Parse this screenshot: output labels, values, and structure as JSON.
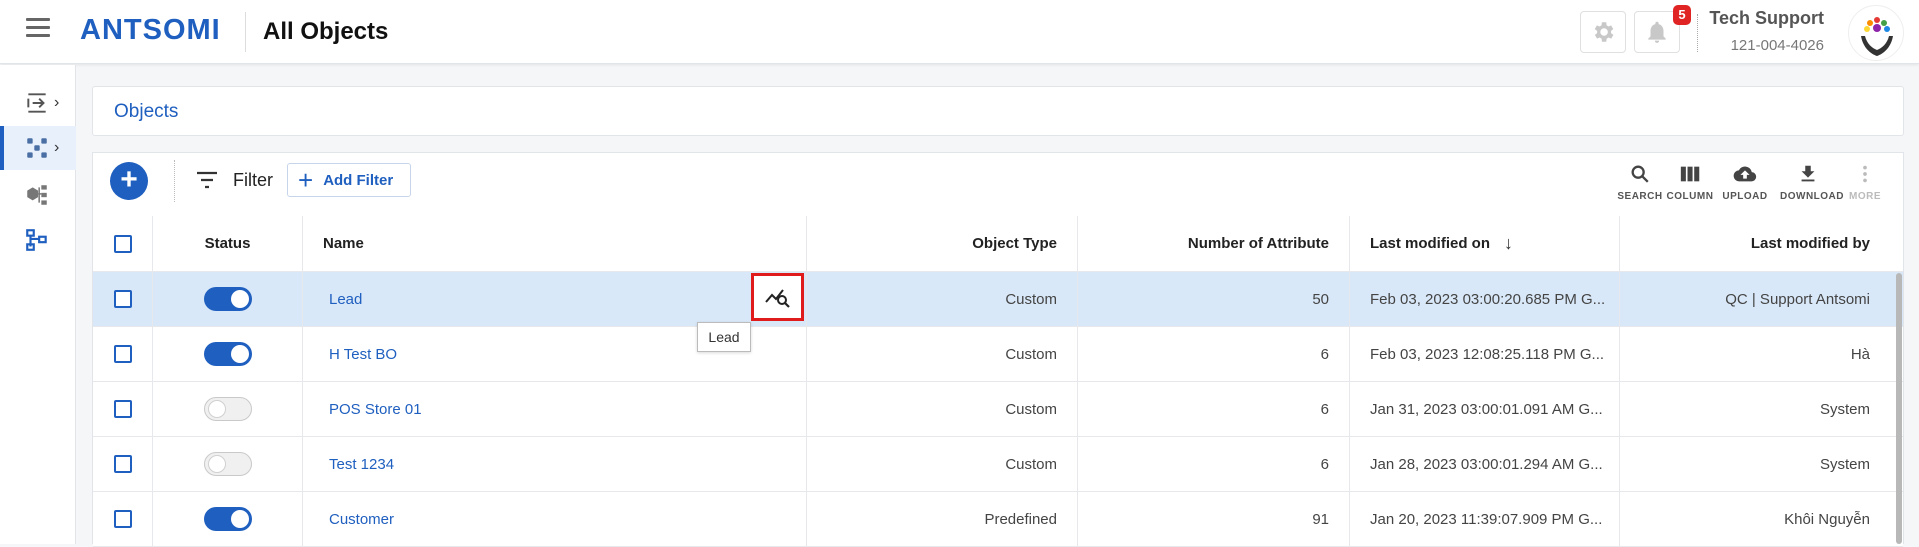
{
  "header": {
    "logo_text": "ANTSOMI",
    "title": "All Objects",
    "notification_count": "5",
    "user_name": "Tech Support",
    "user_phone": "121-004-4026",
    "icons": [
      "menu-icon",
      "gear-icon",
      "bell-icon"
    ]
  },
  "sidebar": {
    "items": [
      {
        "icon": "import-icon",
        "active": false
      },
      {
        "icon": "objects-icon",
        "active": true
      },
      {
        "icon": "cube-tree-icon",
        "active": false
      },
      {
        "icon": "hierarchy-icon",
        "active": false
      }
    ]
  },
  "section_title": "Objects",
  "toolbar": {
    "filter_label": "Filter",
    "add_filter_label": "Add Filter",
    "tools": [
      {
        "label": "SEARCH",
        "icon": "search-icon",
        "enabled": true
      },
      {
        "label": "COLUMN",
        "icon": "column-icon",
        "enabled": true
      },
      {
        "label": "UPLOAD",
        "icon": "upload-icon",
        "enabled": true
      },
      {
        "label": "DOWNLOAD",
        "icon": "download-icon",
        "enabled": true
      },
      {
        "label": "MORE",
        "icon": "more-vert-icon",
        "enabled": false
      }
    ]
  },
  "table": {
    "columns": [
      "Status",
      "Name",
      "Object Type",
      "Number of Attribute",
      "Last modified on",
      "Last modified by"
    ],
    "rows": [
      {
        "status": true,
        "name": "Lead",
        "type": "Custom",
        "attrs": "50",
        "modified_on": "Feb 03, 2023 03:00:20.685 PM G...",
        "modified_by": "QC | Support Antsomi"
      },
      {
        "status": true,
        "name": "H Test BO",
        "type": "Custom",
        "attrs": "6",
        "modified_on": "Feb 03, 2023 12:08:25.118 PM G...",
        "modified_by": "Hà"
      },
      {
        "status": false,
        "name": "POS Store 01",
        "type": "Custom",
        "attrs": "6",
        "modified_on": "Jan 31, 2023 03:00:01.091 AM G...",
        "modified_by": "System"
      },
      {
        "status": false,
        "name": "Test 1234",
        "type": "Custom",
        "attrs": "6",
        "modified_on": "Jan 28, 2023 03:00:01.294 AM G...",
        "modified_by": "System"
      },
      {
        "status": true,
        "name": "Customer",
        "type": "Predefined",
        "attrs": "91",
        "modified_on": "Jan 20, 2023 11:39:07.909 PM G...",
        "modified_by": "Khôi Nguyễn"
      }
    ]
  },
  "tooltip": "Lead",
  "colors": {
    "accent": "#1f5fbf",
    "highlight_border": "#e01b1b",
    "badge": "#e02424",
    "selected_row": "#d9e8f8"
  }
}
